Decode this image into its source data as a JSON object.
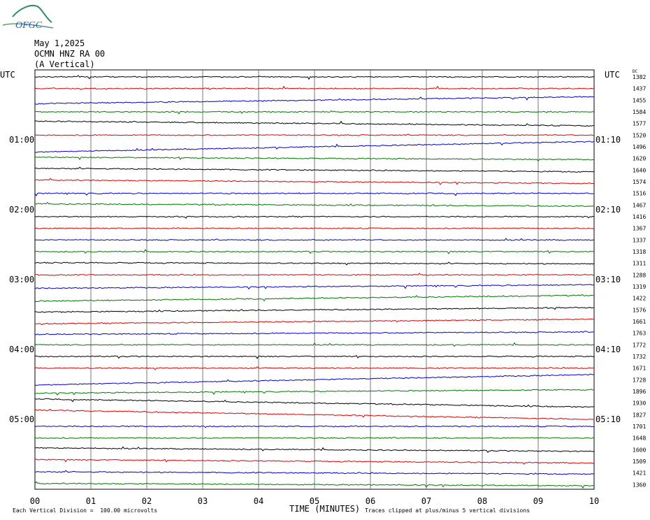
{
  "logo": {
    "text": "OFGC",
    "icon": "station-logo"
  },
  "header": {
    "date": "May 1,2025",
    "station": "OCMN HNZ RA 00",
    "component": "(A Vertical)"
  },
  "labels": {
    "utc_left": "UTC",
    "utc_right": "UTC",
    "dc_header": "DC"
  },
  "left_times": [
    "01:00",
    "02:00",
    "03:00",
    "04:00",
    "05:00"
  ],
  "right_times": [
    "01:10",
    "02:10",
    "03:10",
    "04:10",
    "05:10"
  ],
  "footer": {
    "scale_note": "Each Vertical Division =  100.00 microvolts",
    "xlabel": "TIME (MINUTES)",
    "clip_note": "Traces clipped at plus/minus 5 vertical divisions"
  },
  "colors": [
    "#000000",
    "#dd0000",
    "#0000cc",
    "#007700"
  ],
  "chart_data": {
    "type": "line",
    "x_ticks": [
      "00",
      "01",
      "02",
      "03",
      "04",
      "05",
      "06",
      "07",
      "08",
      "09",
      "10"
    ],
    "xlim": [
      0,
      10
    ],
    "traces_per_row_hour": 6,
    "dc_values": [
      1382,
      1437,
      1455,
      1584,
      1577,
      1520,
      1496,
      1620,
      1640,
      1574,
      1516,
      1467,
      1416,
      1367,
      1337,
      1318,
      1311,
      1288,
      1319,
      1422,
      1576,
      1661,
      1763,
      1772,
      1732,
      1671,
      1728,
      1896,
      1930,
      1827,
      1701,
      1648,
      1600,
      1509,
      1421,
      1360
    ],
    "drift_divisions": [
      0,
      0,
      -0.6,
      0,
      0.4,
      0,
      -0.9,
      0.2,
      0.3,
      0.3,
      0,
      0.2,
      0,
      0,
      0,
      0,
      0.1,
      0,
      -0.3,
      -0.5,
      -0.4,
      -0.4,
      -0.2,
      0,
      0,
      0,
      -0.9,
      -0.3,
      0.7,
      0.8,
      0,
      0,
      0.3,
      0.3,
      0.2,
      0.2
    ],
    "grid": true
  }
}
